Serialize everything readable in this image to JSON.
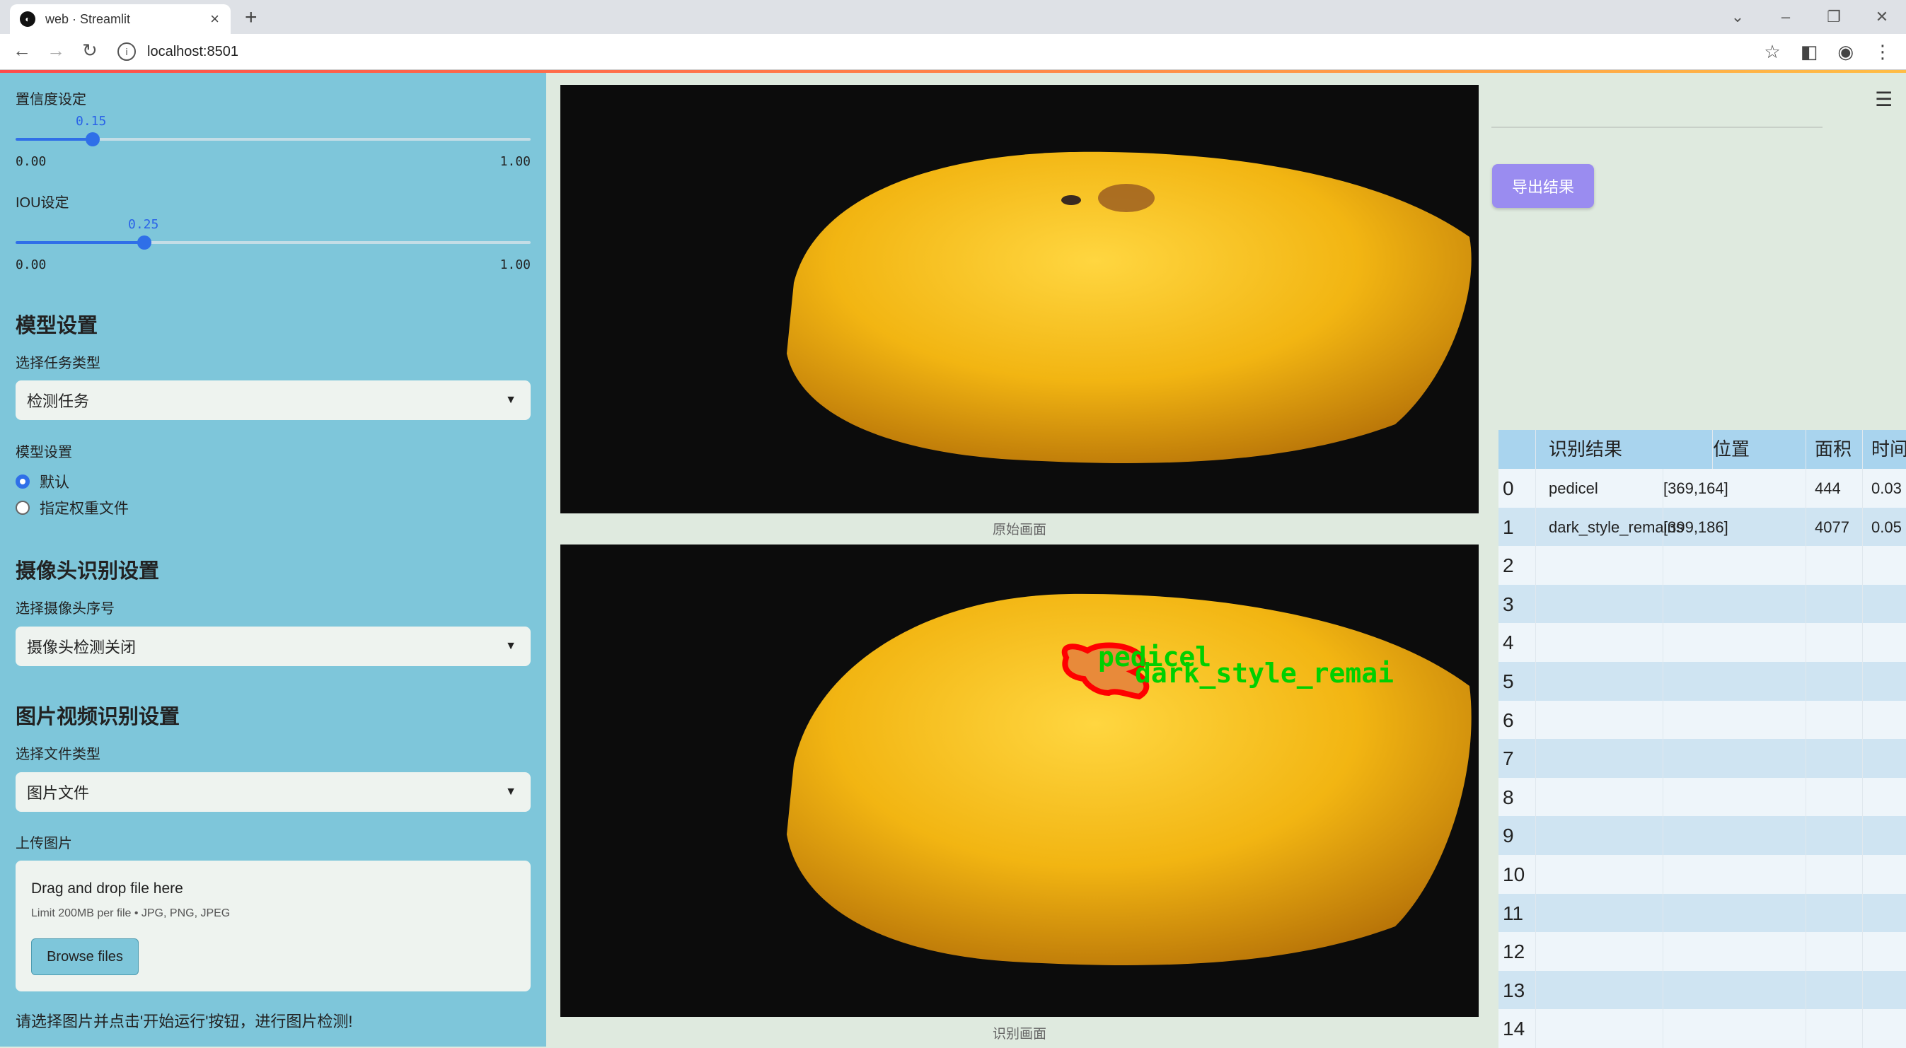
{
  "browser": {
    "tab_title": "web · Streamlit",
    "url": "localhost:8501"
  },
  "sidebar": {
    "confidence": {
      "label": "置信度设定",
      "value": "0.15",
      "value_num": 0.15,
      "min": "0.00",
      "max": "1.00"
    },
    "iou": {
      "label": "IOU设定",
      "value": "0.25",
      "value_num": 0.25,
      "min": "0.00",
      "max": "1.00"
    },
    "model_section": {
      "heading": "模型设置",
      "task_label": "选择任务类型",
      "task_value": "检测任务",
      "model_label": "模型设置",
      "radio_default": "默认",
      "radio_custom": "指定权重文件"
    },
    "camera_section": {
      "heading": "摄像头识别设置",
      "camera_label": "选择摄像头序号",
      "camera_value": "摄像头检测关闭"
    },
    "media_section": {
      "heading": "图片视频识别设置",
      "file_type_label": "选择文件类型",
      "file_type_value": "图片文件",
      "upload_label": "上传图片",
      "dnd_text": "Drag and drop file here",
      "limit_text": "Limit 200MB per file • JPG, PNG, JPEG",
      "browse_label": "Browse files"
    },
    "note": "请选择图片并点击'开始运行'按钮，进行图片检测!"
  },
  "main": {
    "original_caption": "原始画面",
    "result_caption": "识别画面",
    "detection_labels": [
      "pedicel",
      "dark_style_remai"
    ]
  },
  "right": {
    "export_label": "导出结果",
    "table": {
      "headers": [
        "识别结果",
        "位置",
        "面积",
        "时间"
      ],
      "rows": [
        {
          "idx": "0",
          "cls": "pedicel",
          "pos": "[369,164]",
          "area": "444",
          "time": "0.03"
        },
        {
          "idx": "1",
          "cls": "dark_style_remains",
          "pos": "[399,186]",
          "area": "4077",
          "time": "0.05"
        },
        {
          "idx": "2"
        },
        {
          "idx": "3"
        },
        {
          "idx": "4"
        },
        {
          "idx": "5"
        },
        {
          "idx": "6"
        },
        {
          "idx": "7"
        },
        {
          "idx": "8"
        },
        {
          "idx": "9"
        },
        {
          "idx": "10"
        },
        {
          "idx": "11"
        },
        {
          "idx": "12"
        },
        {
          "idx": "13"
        },
        {
          "idx": "14"
        }
      ]
    }
  },
  "colors": {
    "sidebar": "#7ec6da",
    "accent": "#2f6fe8",
    "export_button": "#9a8cf0",
    "detection": "#ff0000",
    "label_text": "#00d000"
  }
}
